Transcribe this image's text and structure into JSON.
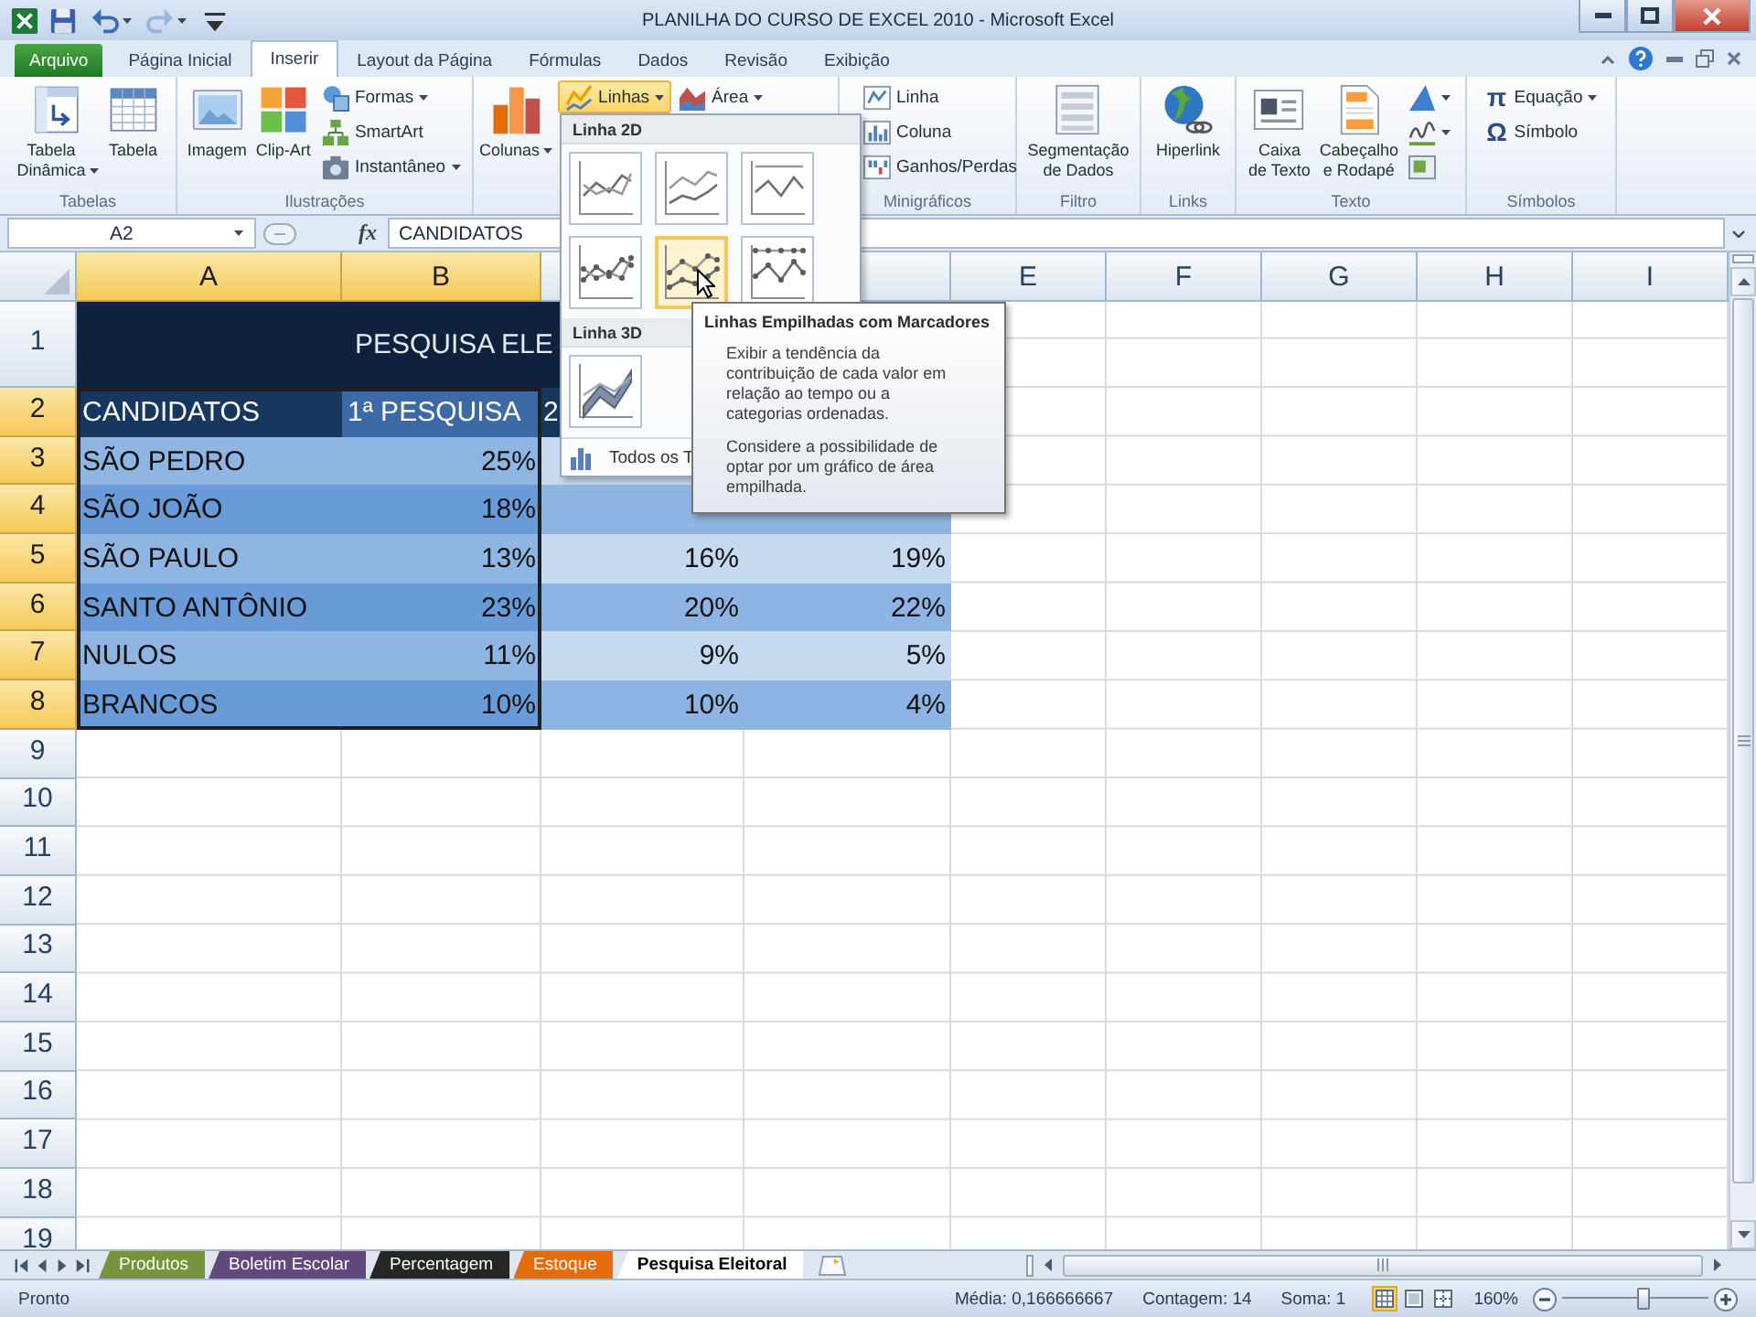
{
  "window": {
    "title": "PLANILHA DO CURSO DE EXCEL 2010 - Microsoft Excel"
  },
  "quick_access": [
    {
      "kind": "save",
      "disabled": false
    },
    {
      "kind": "undo",
      "disabled": false
    },
    {
      "kind": "redo",
      "disabled": true
    },
    {
      "kind": "customize",
      "disabled": false
    }
  ],
  "ribbon_tabs": [
    {
      "label": "Arquivo",
      "kind": "file",
      "selected": false
    },
    {
      "label": "Página Inicial",
      "kind": "tab",
      "selected": false
    },
    {
      "label": "Inserir",
      "kind": "tab",
      "selected": true
    },
    {
      "label": "Layout da Página",
      "kind": "tab",
      "selected": false
    },
    {
      "label": "Fórmulas",
      "kind": "tab",
      "selected": false
    },
    {
      "label": "Dados",
      "kind": "tab",
      "selected": false
    },
    {
      "label": "Revisão",
      "kind": "tab",
      "selected": false
    },
    {
      "label": "Exibição",
      "kind": "tab",
      "selected": false
    }
  ],
  "ribbon": {
    "groups": [
      {
        "label": "Tabelas",
        "items": [
          {
            "kind": "large",
            "label": "Tabela\nDinâmica",
            "menu": true,
            "open": false
          },
          {
            "kind": "large",
            "label": "Tabela",
            "menu": false,
            "open": false
          }
        ]
      },
      {
        "label": "Ilustrações",
        "items": [
          {
            "kind": "large",
            "label": "Imagem",
            "menu": false,
            "open": false
          },
          {
            "kind": "large",
            "label": "Clip-Art",
            "menu": false,
            "open": false
          },
          {
            "kind": "stack",
            "buttons": [
              {
                "label": "Formas",
                "menu": true,
                "open": false
              },
              {
                "label": "SmartArt",
                "menu": false,
                "open": false
              },
              {
                "label": "Instantâneo",
                "menu": true,
                "open": false
              }
            ]
          }
        ]
      },
      {
        "items": [
          {
            "kind": "large",
            "label": "Colunas",
            "menu": true,
            "open": false
          },
          {
            "kind": "stack",
            "buttons": [
              {
                "label": "Linhas",
                "menu": true,
                "open": true
              }
            ]
          },
          {
            "kind": "stack",
            "buttons": [
              {
                "label": "Área",
                "menu": true,
                "open": false
              }
            ]
          }
        ]
      },
      {
        "label": "Minigráficos",
        "items": [
          {
            "kind": "stack",
            "buttons": [
              {
                "label": "Linha",
                "menu": false,
                "open": false
              },
              {
                "label": "Coluna",
                "menu": false,
                "open": false
              },
              {
                "label": "Ganhos/Perdas",
                "menu": false,
                "open": false
              }
            ]
          }
        ]
      },
      {
        "label": "Filtro",
        "items": [
          {
            "kind": "large",
            "label": "Segmentação\nde Dados",
            "menu": false,
            "open": false
          }
        ]
      },
      {
        "label": "Links",
        "items": [
          {
            "kind": "large",
            "label": "Hiperlink",
            "menu": false,
            "open": false
          }
        ]
      },
      {
        "label": "Texto",
        "items": [
          {
            "kind": "large",
            "label": "Caixa\nde Texto",
            "menu": false,
            "open": false
          },
          {
            "kind": "large",
            "label": "Cabeçalho\ne Rodapé",
            "menu": false,
            "open": false
          },
          {
            "kind": "stack",
            "buttons": [
              {
                "menu": true,
                "open": false
              },
              {
                "menu": true,
                "open": false
              },
              {
                "menu": false,
                "open": false
              }
            ]
          }
        ]
      },
      {
        "label": "Símbolos",
        "items": [
          {
            "kind": "stack",
            "buttons": [
              {
                "glyph": "π",
                "label": "Equação",
                "menu": true,
                "open": false
              },
              {
                "glyph": "Ω",
                "label": "Símbolo",
                "menu": false,
                "open": false
              }
            ]
          }
        ]
      }
    ]
  },
  "formula_bar": {
    "name_box": "A2",
    "function_button": "fx",
    "formula": "CANDIDATOS"
  },
  "grid": {
    "columns": [
      {
        "label": "A",
        "selected": true
      },
      {
        "label": "B",
        "selected": true
      },
      {
        "selected": false
      },
      {
        "selected": false
      },
      {
        "label": "E",
        "selected": false
      },
      {
        "label": "F",
        "selected": false
      },
      {
        "label": "G",
        "selected": false
      },
      {
        "label": "H",
        "selected": false
      },
      {
        "label": "I",
        "selected": false
      }
    ],
    "rows": [
      {
        "number": "1",
        "kind": "title",
        "selected": false,
        "title": "PESQUISA ELE"
      },
      {
        "number": "2",
        "kind": "header",
        "selected": true,
        "cells": [
          {
            "text": "CANDIDATOS",
            "active": true
          },
          {
            "text": "1ª PESQUISA",
            "active": false
          },
          {
            "text": "2",
            "active": false
          }
        ]
      },
      {
        "number": "3",
        "kind": "data",
        "selected": true,
        "cells": [
          {
            "text": "SÃO PEDRO",
            "active": false
          },
          {
            "text": "25%",
            "active": false
          },
          {
            "active": false
          }
        ]
      },
      {
        "number": "4",
        "kind": "data",
        "selected": true,
        "cells": [
          {
            "text": "SÃO JOÃO",
            "active": false
          },
          {
            "text": "18%",
            "active": false
          },
          {
            "active": false
          },
          {
            "active": false
          }
        ]
      },
      {
        "number": "5",
        "kind": "data",
        "selected": true,
        "cells": [
          {
            "text": "SÃO PAULO",
            "active": false
          },
          {
            "text": "13%",
            "active": false
          },
          {
            "text": "16%",
            "active": false
          },
          {
            "text": "19%",
            "active": false
          }
        ]
      },
      {
        "number": "6",
        "kind": "data",
        "selected": true,
        "cells": [
          {
            "text": "SANTO ANTÔNIO",
            "active": false
          },
          {
            "text": "23%",
            "active": false
          },
          {
            "text": "20%",
            "active": false
          },
          {
            "text": "22%",
            "active": false
          }
        ]
      },
      {
        "number": "7",
        "kind": "data",
        "selected": true,
        "cells": [
          {
            "text": "NULOS",
            "active": false
          },
          {
            "text": "11%",
            "active": false
          },
          {
            "text": "9%",
            "active": false
          },
          {
            "text": "5%",
            "active": false
          }
        ]
      },
      {
        "number": "8",
        "kind": "data",
        "selected": true,
        "cells": [
          {
            "text": "BRANCOS",
            "active": false
          },
          {
            "text": "10%",
            "active": false
          },
          {
            "text": "10%",
            "active": false
          },
          {
            "text": "4%",
            "active": false
          }
        ]
      },
      {
        "number": "9",
        "kind": "blank",
        "selected": false
      },
      {
        "number": "10",
        "kind": "blank",
        "selected": false
      },
      {
        "number": "11",
        "kind": "blank",
        "selected": false
      },
      {
        "number": "12",
        "kind": "blank",
        "selected": false
      },
      {
        "number": "13",
        "kind": "blank",
        "selected": false
      },
      {
        "number": "14",
        "kind": "blank",
        "selected": false
      },
      {
        "number": "15",
        "kind": "blank",
        "selected": false
      },
      {
        "number": "16",
        "kind": "blank",
        "selected": false
      },
      {
        "number": "17",
        "kind": "blank",
        "selected": false
      },
      {
        "number": "18",
        "kind": "blank",
        "selected": false
      },
      {
        "number": "19",
        "kind": "blank",
        "selected": false
      }
    ]
  },
  "line_menu": {
    "sections": [
      {
        "title": "Linha 2D",
        "items": [
          {
            "kind": "line",
            "selected": false
          },
          {
            "kind": "stacked",
            "selected": false
          },
          {
            "kind": "percent",
            "selected": false
          },
          {
            "kind": "line-markers",
            "selected": false
          },
          {
            "kind": "stacked-markers",
            "selected": true
          },
          {
            "kind": "percent-markers",
            "selected": false
          }
        ]
      },
      {
        "title": "Linha 3D",
        "items": [
          {
            "kind": "line-3d",
            "selected": false
          }
        ]
      }
    ],
    "footer": "Todos os T"
  },
  "tooltip": {
    "title": "Linhas Empilhadas com Marcadores",
    "paragraphs": [
      "Exibir a tendência da contribuição de cada valor em relação ao tempo ou a categorias ordenadas.",
      "Considere a possibilidade de optar por um gráfico de área empilhada."
    ]
  },
  "sheet_tabs": [
    {
      "label": "Produtos",
      "color": "#77933c",
      "selected": false
    },
    {
      "label": "Boletim Escolar",
      "color": "#604a7b",
      "selected": false
    },
    {
      "label": "Percentagem",
      "color": "#262626",
      "selected": false
    },
    {
      "label": "Estoque",
      "color": "#e46c0a",
      "selected": false
    },
    {
      "label": "Pesquisa Eleitoral",
      "selected": true
    }
  ],
  "status_bar": {
    "status": "Pronto",
    "average": "Média: 0,166666667",
    "count": "Contagem: 14",
    "sum": "Soma: 1",
    "views": [
      {
        "kind": "normal",
        "selected": true
      },
      {
        "kind": "page-layout",
        "selected": false
      },
      {
        "kind": "page-break",
        "selected": false
      }
    ],
    "zoom": "160%",
    "zoom_slider": {
      "level": 0.56
    }
  }
}
